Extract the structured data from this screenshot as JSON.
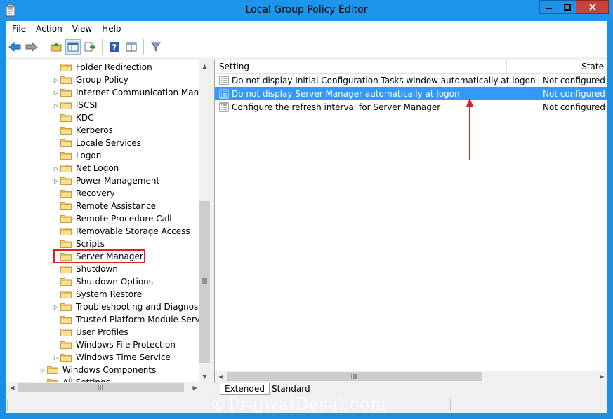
{
  "window": {
    "title": "Local Group Policy Editor",
    "controls": {
      "minimize": "minimize",
      "maximize": "maximize",
      "close": "close"
    }
  },
  "menubar": {
    "items": [
      "File",
      "Action",
      "View",
      "Help"
    ]
  },
  "toolbar": {
    "icons": [
      "back-icon",
      "forward-icon",
      "up-folder-icon",
      "show-hide-tree-icon",
      "export-list-icon",
      "help-icon",
      "properties-view-icon",
      "filter-icon"
    ]
  },
  "tree": {
    "items": [
      {
        "label": "Folder Redirection",
        "expandable": false
      },
      {
        "label": "Group Policy",
        "expandable": true
      },
      {
        "label": "Internet Communication Manage",
        "expandable": true
      },
      {
        "label": "iSCSI",
        "expandable": true
      },
      {
        "label": "KDC",
        "expandable": false
      },
      {
        "label": "Kerberos",
        "expandable": false
      },
      {
        "label": "Locale Services",
        "expandable": false
      },
      {
        "label": "Logon",
        "expandable": false
      },
      {
        "label": "Net Logon",
        "expandable": true
      },
      {
        "label": "Power Management",
        "expandable": true
      },
      {
        "label": "Recovery",
        "expandable": false
      },
      {
        "label": "Remote Assistance",
        "expandable": false
      },
      {
        "label": "Remote Procedure Call",
        "expandable": false
      },
      {
        "label": "Removable Storage Access",
        "expandable": false
      },
      {
        "label": "Scripts",
        "expandable": false
      },
      {
        "label": "Server Manager",
        "expandable": false,
        "highlighted": true
      },
      {
        "label": "Shutdown",
        "expandable": false
      },
      {
        "label": "Shutdown Options",
        "expandable": false
      },
      {
        "label": "System Restore",
        "expandable": false
      },
      {
        "label": "Troubleshooting and Diagnostics",
        "expandable": true
      },
      {
        "label": "Trusted Platform Module Services",
        "expandable": false
      },
      {
        "label": "User Profiles",
        "expandable": false
      },
      {
        "label": "Windows File Protection",
        "expandable": false
      },
      {
        "label": "Windows Time Service",
        "expandable": true
      },
      {
        "label": "Windows Components",
        "expandable": true,
        "level": 0
      },
      {
        "label": "All Settings",
        "expandable": false,
        "level": 0
      }
    ]
  },
  "list": {
    "columns": {
      "setting": "Setting",
      "state": "State"
    },
    "rows": [
      {
        "setting": "Do not display Initial Configuration Tasks window automatically at logon",
        "state": "Not configured",
        "selected": false
      },
      {
        "setting": "Do not display Server Manager automatically at logon",
        "state": "Not configured",
        "selected": true
      },
      {
        "setting": "Configure the refresh interval for Server Manager",
        "state": "Not configured",
        "selected": false
      }
    ]
  },
  "tabs": {
    "extended": "Extended",
    "standard": "Standard"
  },
  "watermark": "©PrajwalDesai.com",
  "colors": {
    "selection": "#3399ff",
    "annotation": "#e02020",
    "titlebar": "#1d95ea"
  }
}
